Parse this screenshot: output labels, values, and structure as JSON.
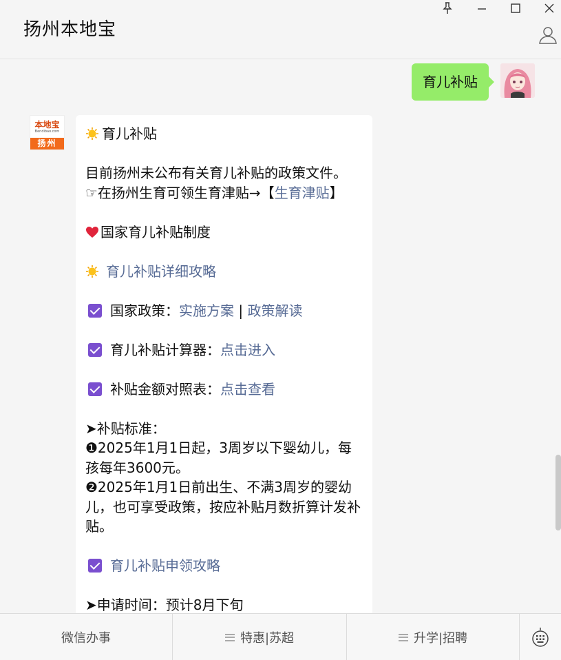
{
  "header": {
    "title": "扬州本地宝",
    "pin_icon": "pin-icon",
    "minimize_icon": "minimize-icon",
    "maximize_icon": "maximize-icon",
    "close_icon": "close-icon",
    "user_icon": "user-icon"
  },
  "my_message": {
    "text": "育儿补贴"
  },
  "bot_avatar": {
    "logo_text": "本地宝",
    "logo_domain": "Bendibao.com",
    "city": "扬州"
  },
  "bot_message": {
    "title": "育儿补贴",
    "intro_line1": "目前扬州未公布有关育儿补贴的政策文件。",
    "intro_line2_prefix": "☞在扬州生育可领生育津贴→【",
    "intro_line2_link": "生育津贴",
    "intro_line2_suffix": "】",
    "national_heading": "国家育儿补贴制度",
    "guide_link": "育儿补贴详细攻略",
    "policy_label": "国家政策：",
    "policy_link1": "实施方案",
    "policy_sep": " | ",
    "policy_link2": "政策解读",
    "calculator_label": "育儿补贴计算器：",
    "calculator_link": "点击进入",
    "amount_label": "补贴金额对照表：",
    "amount_link": "点击查看",
    "standard_heading": "➤补贴标准：",
    "standard_item1": "❶2025年1月1日起，3周岁以下婴幼儿，每孩每年3600元。",
    "standard_item2": "❷2025年1月1日前出生、不满3周岁的婴幼儿，也可享受政策，按应补贴月数折算计发补贴。",
    "apply_link": "育儿补贴申领攻略",
    "apply_time": "➤申请时间：预计8月下旬"
  },
  "bottom_menu": {
    "item1": "微信办事",
    "item2": "特惠|苏超",
    "item3": "升学|招聘",
    "keyboard_icon": "keyboard-icon"
  },
  "colors": {
    "my_bubble": "#95ec69",
    "link": "#576b95",
    "check": "#7a4fcf",
    "logo_orange": "#f26a1b"
  }
}
